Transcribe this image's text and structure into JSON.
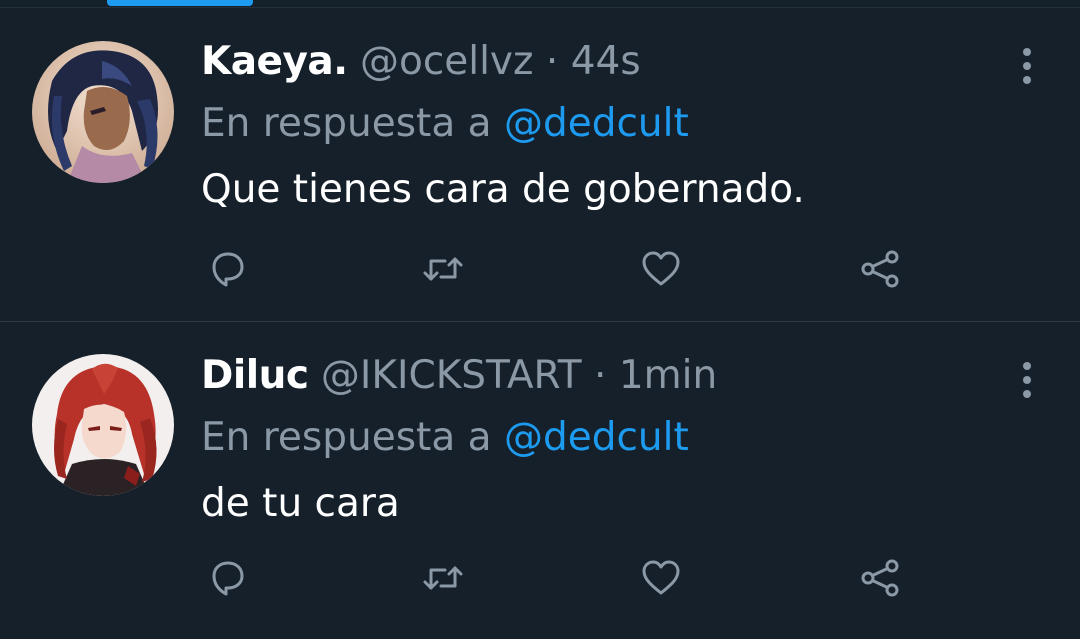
{
  "tweets": [
    {
      "name": "Kaeya.",
      "handle": "@ocellvz",
      "separator": "·",
      "time": "44s",
      "reply_prefix": "En respuesta a",
      "reply_mention": "@dedcult",
      "text": "Que tienes cara de gobernado.",
      "avatar_icon": "avatar-kaeya"
    },
    {
      "name": "Diluc",
      "handle": "@IKICKSTART",
      "separator": "·",
      "time": "1min",
      "reply_prefix": "En respuesta a",
      "reply_mention": "@dedcult",
      "text": "de tu cara",
      "avatar_icon": "avatar-diluc"
    }
  ],
  "icons": {
    "reply": "reply-icon",
    "retweet": "retweet-icon",
    "like": "like-icon",
    "share": "share-icon",
    "more": "more-vertical-icon"
  },
  "colors": {
    "background": "#15202b",
    "accent": "#1d9bf0",
    "secondary_text": "#8b98a5",
    "primary_text": "#ffffff",
    "divider": "#2f3a45"
  }
}
